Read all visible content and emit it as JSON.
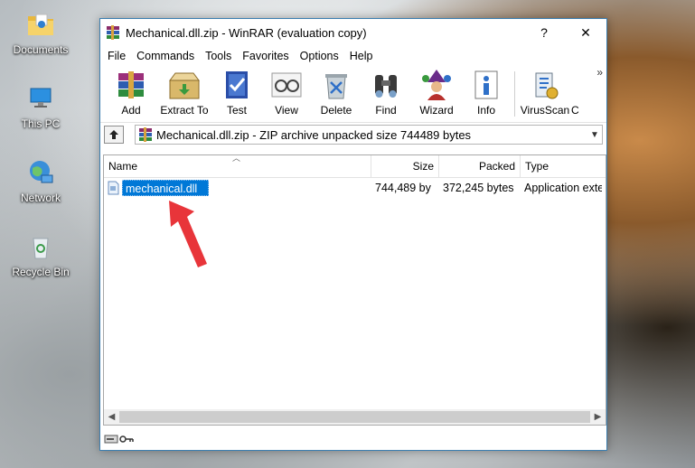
{
  "desktop": {
    "icons": [
      {
        "label": "Documents"
      },
      {
        "label": "This PC"
      },
      {
        "label": "Network"
      },
      {
        "label": "Recycle Bin"
      }
    ]
  },
  "window": {
    "title": "Mechanical.dll.zip - WinRAR (evaluation copy)",
    "help_glyph": "?",
    "close_glyph": "✕"
  },
  "menu": [
    "File",
    "Commands",
    "Tools",
    "Favorites",
    "Options",
    "Help"
  ],
  "toolbar": {
    "buttons": [
      {
        "label": "Add",
        "icon": "add-archive-icon"
      },
      {
        "label": "Extract To",
        "icon": "extract-to-icon"
      },
      {
        "label": "Test",
        "icon": "test-icon"
      },
      {
        "label": "View",
        "icon": "view-icon"
      },
      {
        "label": "Delete",
        "icon": "delete-icon"
      },
      {
        "label": "Find",
        "icon": "find-binoculars-icon"
      },
      {
        "label": "Wizard",
        "icon": "wizard-icon"
      },
      {
        "label": "Info",
        "icon": "info-icon"
      },
      {
        "label": "VirusScan",
        "icon": "virusscan-icon"
      },
      {
        "label": "C",
        "icon": "comment-icon"
      }
    ],
    "overflow_glyph": "»"
  },
  "address": {
    "text": "Mechanical.dll.zip - ZIP archive unpacked size 744489 bytes"
  },
  "filelist": {
    "columns": [
      "Name",
      "Size",
      "Packed",
      "Type"
    ],
    "rows": [
      {
        "name": "mechanical.dll",
        "size": "744,489 by",
        "packed": "372,245 bytes",
        "type": "Application exte"
      }
    ]
  },
  "colors": {
    "selection": "#0078d7",
    "annotation_arrow": "#e8353a"
  }
}
